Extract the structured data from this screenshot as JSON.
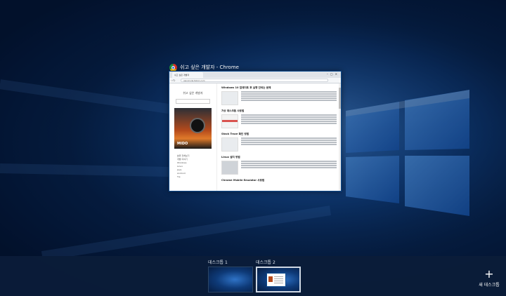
{
  "window": {
    "title": "쉬고 싶은 개발자 - Chrome",
    "tab_label": "쉬고 싶은 개발자",
    "url": "ganzicode.tistory.com",
    "blog_title": "쉬고 싶은 개발자",
    "ad_brand": "MIDO",
    "posts": [
      {
        "title": "Windows 10 업데이트 후 실행 안되는 문제"
      },
      {
        "title": "가상 데스크톱 사용법"
      },
      {
        "title": "Stack Trace 확인 방법"
      },
      {
        "title": "Linux 설치 방법"
      },
      {
        "title": "Chrome Mobile Emulator 사용법"
      }
    ],
    "categories": [
      "분류 전체보기",
      "개발 이야기",
      "Windows",
      "Linux",
      "Java",
      "Android",
      "Tip"
    ]
  },
  "taskview": {
    "desktops": [
      {
        "label": "데스크톱 1"
      },
      {
        "label": "데스크톱 2"
      }
    ],
    "new_desktop_label": "새 데스크톱",
    "new_desktop_icon": "plus-icon"
  },
  "colors": {
    "wallpaper_blue": "#10407f",
    "bottombar": "#0a1c38",
    "selected_border": "#cfd8e4"
  }
}
